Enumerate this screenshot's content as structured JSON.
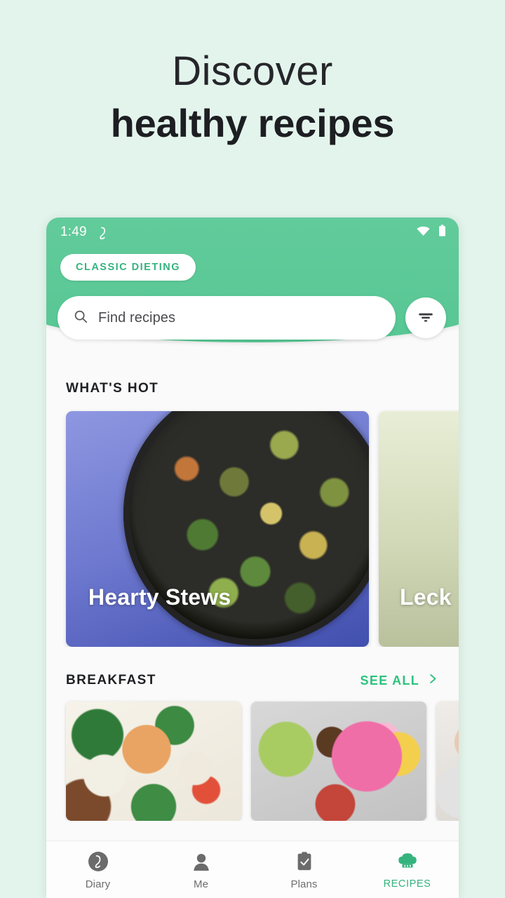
{
  "headline": {
    "line1": "Discover",
    "line2": "healthy recipes"
  },
  "colors": {
    "page_background": "#e3f4ec",
    "header_green": "#5cc997",
    "accent_green": "#2ec27e",
    "badge_text_green": "#35b37e",
    "text_dark": "#1f2023"
  },
  "phone": {
    "statusbar": {
      "time": "1:49",
      "app_icon": "lifesum-l-icon",
      "wifi_icon": "wifi-icon",
      "battery_icon": "battery-icon"
    },
    "badge": {
      "label": "CLASSIC DIETING"
    },
    "search": {
      "placeholder": "Find recipes",
      "search_icon": "search-icon",
      "filter_icon": "filter-icon"
    },
    "sections": [
      {
        "title": "WHAT'S HOT",
        "see_all": null,
        "cards": [
          {
            "title": "Hearty Stews",
            "image": "skillet-of-stir-fried-vegetables"
          },
          {
            "title": "Leck",
            "image": "eggplant-on-olive-background"
          }
        ]
      },
      {
        "title": "BREAKFAST",
        "see_all": "SEE ALL",
        "see_all_icon": "chevron-right-icon",
        "cards": [
          {
            "image": "pickled-vegetables-jar-with-herbs"
          },
          {
            "image": "pink-lunchbox-with-bread-and-banana"
          },
          {
            "image": "breakfast-plate-partial"
          }
        ]
      }
    ],
    "bottom_nav": [
      {
        "label": "Diary",
        "icon": "lifesum-circle-icon",
        "active": false
      },
      {
        "label": "Me",
        "icon": "person-icon",
        "active": false
      },
      {
        "label": "Plans",
        "icon": "clipboard-check-icon",
        "active": false
      },
      {
        "label": "RECIPES",
        "icon": "chef-hat-icon",
        "active": true
      }
    ]
  }
}
